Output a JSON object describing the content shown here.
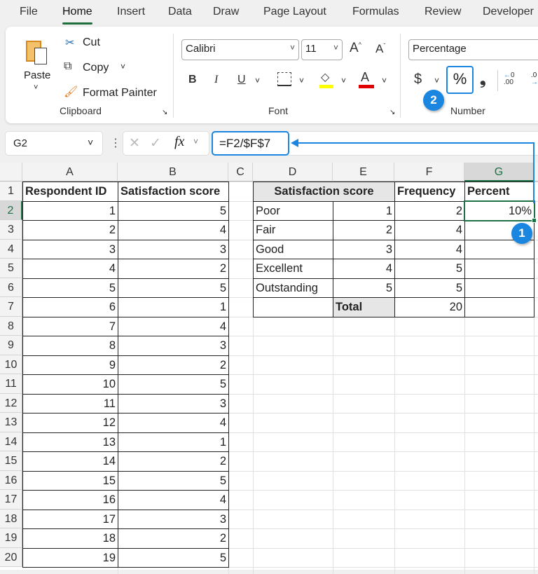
{
  "tabs": [
    "File",
    "Home",
    "Insert",
    "Data",
    "Draw",
    "Page Layout",
    "Formulas",
    "Review",
    "Developer"
  ],
  "active_tab": "Home",
  "clipboard": {
    "paste": "Paste",
    "cut": "Cut",
    "copy": "Copy",
    "format_painter": "Format Painter",
    "group": "Clipboard"
  },
  "font": {
    "name": "Calibri",
    "size": "11",
    "bold": "B",
    "italic": "I",
    "underline": "U",
    "group": "Font",
    "fill_color": "#ffff00",
    "font_color": "#e00000"
  },
  "number": {
    "format": "Percentage",
    "currency": "$",
    "percent": "%",
    "comma": "❟",
    "group": "Number"
  },
  "badges": {
    "one": "1",
    "two": "2"
  },
  "formula_bar": {
    "name_box": "G2",
    "fx": "fx",
    "formula": "=F2/$F$7"
  },
  "columns": [
    "A",
    "B",
    "C",
    "D",
    "E",
    "F",
    "G"
  ],
  "row_numbers": [
    "1",
    "2",
    "3",
    "4",
    "5",
    "6",
    "7",
    "8",
    "9",
    "10",
    "11",
    "12",
    "13",
    "14",
    "15",
    "16",
    "17",
    "18",
    "19",
    "20"
  ],
  "table1": {
    "headers": [
      "Respondent ID",
      "Satisfaction score"
    ],
    "rows": [
      [
        "1",
        "5"
      ],
      [
        "2",
        "4"
      ],
      [
        "3",
        "3"
      ],
      [
        "4",
        "2"
      ],
      [
        "5",
        "5"
      ],
      [
        "6",
        "1"
      ],
      [
        "7",
        "4"
      ],
      [
        "8",
        "3"
      ],
      [
        "9",
        "2"
      ],
      [
        "10",
        "5"
      ],
      [
        "11",
        "3"
      ],
      [
        "12",
        "4"
      ],
      [
        "13",
        "1"
      ],
      [
        "14",
        "2"
      ],
      [
        "15",
        "5"
      ],
      [
        "16",
        "4"
      ],
      [
        "17",
        "3"
      ],
      [
        "18",
        "2"
      ],
      [
        "19",
        "5"
      ]
    ]
  },
  "table2": {
    "headers": [
      "Satisfaction score",
      "Frequency",
      "Percent"
    ],
    "rows": [
      [
        "Poor",
        "1",
        "2",
        "10%"
      ],
      [
        "Fair",
        "2",
        "4",
        ""
      ],
      [
        "Good",
        "3",
        "4",
        ""
      ],
      [
        "Excellent",
        "4",
        "5",
        ""
      ],
      [
        "Outstanding",
        "5",
        "5",
        ""
      ]
    ],
    "total_label": "Total",
    "total": "20"
  },
  "accent": "#1a86e0",
  "selection": "#1e7145"
}
